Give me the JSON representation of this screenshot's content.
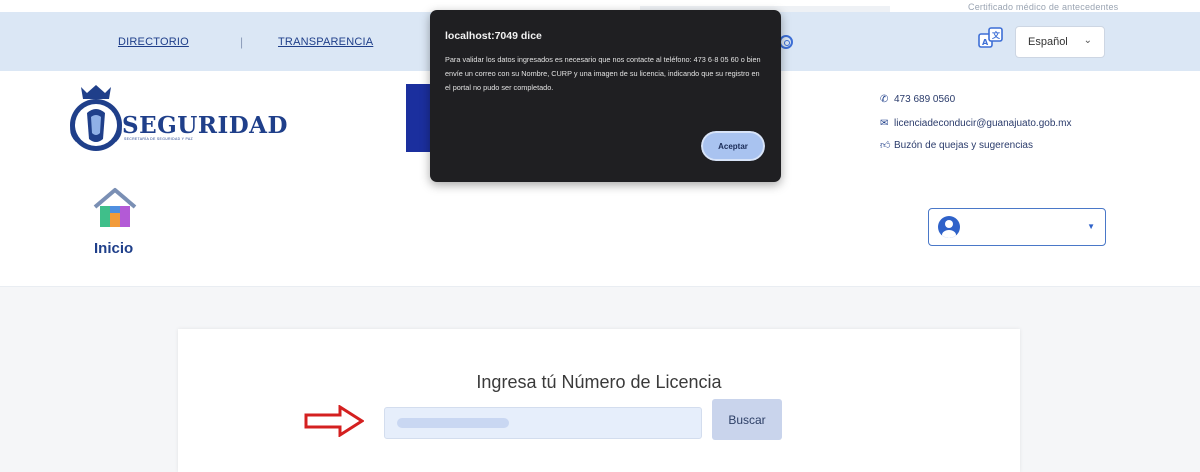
{
  "topbar": {
    "directorio": "DIRECTORIO",
    "separator": "|",
    "transparencia": "TRANSPARENCIA",
    "faded_text": "Certificado médico de antecedentes",
    "language": "Español"
  },
  "logo": {
    "name": "SEGURIDAD",
    "subtitle": "SECRETARÍA DE SEGURIDAD Y PAZ"
  },
  "contact": {
    "phone": "473 689 0560",
    "email": "licenciadeconducir@guanajuato.gob.mx",
    "complaints": "Buzón de quejas y sugerencias"
  },
  "home": {
    "label": "Inicio"
  },
  "main": {
    "title": "Ingresa tú Número de Licencia",
    "search_button": "Buscar"
  },
  "dialog": {
    "title": "localhost:7049 dice",
    "message": "Para validar los datos ingresados es necesario que nos contacte al teléfono: 473 6·8 05 60 o bien envíe un correo con su Nombre, CURP y una imagen de su licencia, indicando que su registro en el portal no pudo ser completado.",
    "accept": "Aceptar"
  },
  "colors": {
    "topbar": "#dbe7f5",
    "brand_blue": "#1f3f8a",
    "dialog_bg": "#1f1f22",
    "arrow_red": "#d42020"
  }
}
